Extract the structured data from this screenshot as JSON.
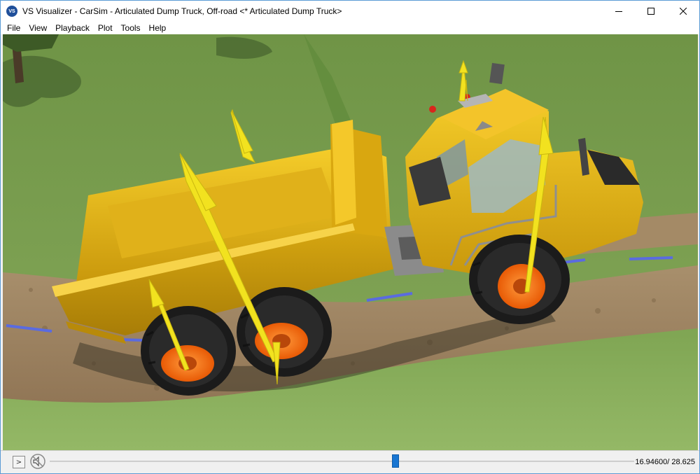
{
  "window": {
    "title": "VS Visualizer - CarSim - Articulated Dump Truck, Off-road <* Articulated Dump Truck>",
    "app_icon_text": "VS",
    "controls": {
      "minimize": "minimize-icon",
      "maximize": "maximize-icon",
      "close": "close-icon"
    }
  },
  "menu": {
    "items": [
      {
        "label": "File"
      },
      {
        "label": "View"
      },
      {
        "label": "Playback"
      },
      {
        "label": "Plot"
      },
      {
        "label": "Tools"
      },
      {
        "label": "Help"
      }
    ]
  },
  "scene": {
    "description_icon": "3d-viewport",
    "colors": {
      "grass": "#7da051",
      "dirt": "#a08662",
      "truck_body": "#e8b817",
      "rim": "#ff6a13",
      "force_arrow": "#f2e21f",
      "lane_marker": "#5a6be0"
    }
  },
  "playback": {
    "play_label": ">",
    "mute_icon": "mute-icon",
    "position_fraction": 0.592,
    "time_current": "16.94600",
    "time_total": "28.625",
    "time_readout": "16.94600/ 28.625"
  }
}
